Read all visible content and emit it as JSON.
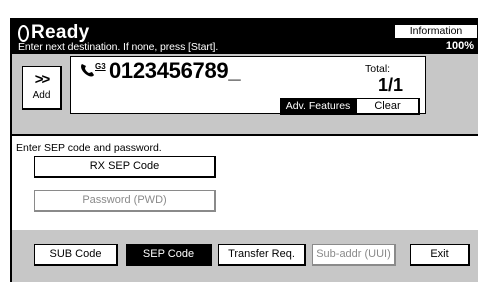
{
  "header": {
    "status": "Ready",
    "instruction": "Enter next destination. If none, press [Start].",
    "memory_percent": "100%",
    "information_label": "Information"
  },
  "destination": {
    "add_arrows": ">>",
    "add_label": "Add",
    "line_tag": "G3",
    "number": "0123456789_",
    "total_label": "Total:",
    "total_value": "1/1",
    "adv_features_label": "Adv. Features",
    "clear_label": "Clear"
  },
  "sep_panel": {
    "prompt": "Enter SEP code and password.",
    "rx_sep_code_label": "RX SEP Code",
    "password_label": "Password (PWD)"
  },
  "tabs": [
    {
      "label": "SUB Code",
      "selected": false,
      "enabled": true
    },
    {
      "label": "SEP Code",
      "selected": true,
      "enabled": true
    },
    {
      "label": "Transfer Req.",
      "selected": false,
      "enabled": true
    },
    {
      "label": "Sub-addr (UUI)",
      "selected": false,
      "enabled": false
    }
  ],
  "exit_label": "Exit",
  "colors": {
    "selected_bg": "#000000",
    "pattern_bg": "#d6d6d6",
    "disabled_text": "#8a8a8a"
  }
}
